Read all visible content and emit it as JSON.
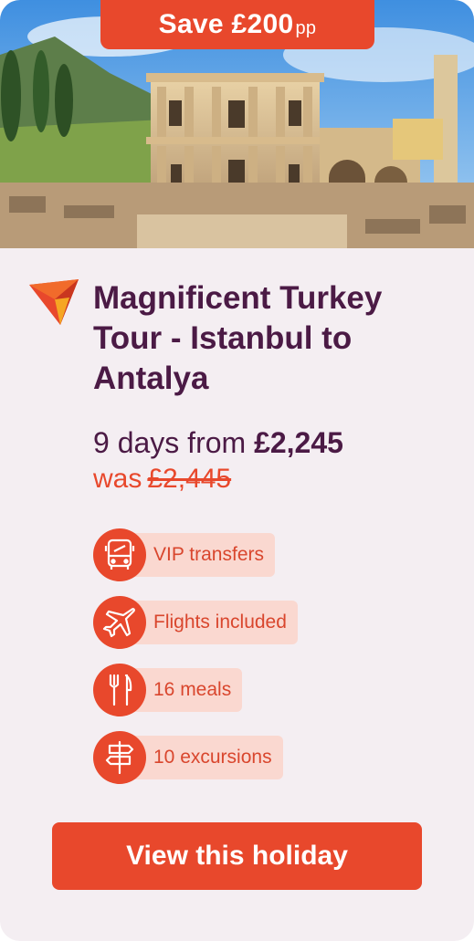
{
  "badge": {
    "save_text": "Save £200",
    "suffix": "pp"
  },
  "hero": {
    "image_alt": "Library of Celsus ruins, Ephesus"
  },
  "holiday": {
    "title": "Magnificent Turkey Tour - Istanbul to Antalya",
    "duration_prefix": "9 days from",
    "price": "£2,245",
    "was_label": "was",
    "was_price": "£2,445"
  },
  "features": [
    {
      "icon": "bus-icon",
      "label": "VIP transfers"
    },
    {
      "icon": "plane-icon",
      "label": "Flights included"
    },
    {
      "icon": "cutlery-icon",
      "label": "16 meals"
    },
    {
      "icon": "signpost-icon",
      "label": "10 excursions"
    }
  ],
  "cta": {
    "label": "View this holiday"
  },
  "colors": {
    "accent": "#e8482c",
    "text": "#4b1a45",
    "pill": "#fad8d0",
    "card": "#f4eef2"
  }
}
